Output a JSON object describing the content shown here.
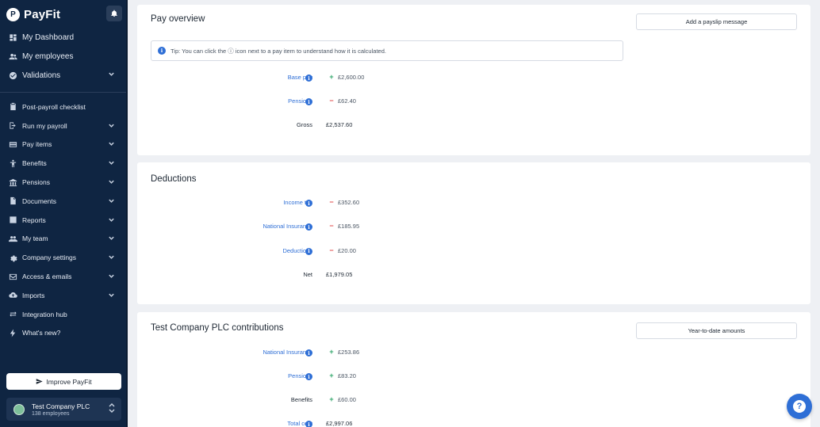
{
  "app": {
    "name": "PayFit"
  },
  "sidebar": {
    "top_items": [
      {
        "label": "My Dashboard",
        "icon": "dashboard-icon"
      },
      {
        "label": "My employees",
        "icon": "users-icon"
      },
      {
        "label": "Validations",
        "icon": "check-circle-icon",
        "has_chevron": true
      }
    ],
    "items": [
      {
        "label": "Post-payroll checklist",
        "icon": "clipboard-icon"
      },
      {
        "label": "Run my payroll",
        "icon": "run-icon",
        "has_chevron": true
      },
      {
        "label": "Pay items",
        "icon": "card-icon",
        "has_chevron": true
      },
      {
        "label": "Benefits",
        "icon": "person-icon",
        "has_chevron": true
      },
      {
        "label": "Pensions",
        "icon": "bank-icon",
        "has_chevron": true
      },
      {
        "label": "Documents",
        "icon": "document-icon",
        "has_chevron": true
      },
      {
        "label": "Reports",
        "icon": "report-icon",
        "has_chevron": true
      },
      {
        "label": "My team",
        "icon": "team-icon",
        "has_chevron": true
      },
      {
        "label": "Company settings",
        "icon": "gear-icon",
        "has_chevron": true
      },
      {
        "label": "Access & emails",
        "icon": "mail-icon",
        "has_chevron": true
      },
      {
        "label": "Imports",
        "icon": "cloud-upload-icon",
        "has_chevron": true
      },
      {
        "label": "Integration hub",
        "icon": "arrows-icon"
      },
      {
        "label": "What's new?",
        "icon": "bolt-icon"
      }
    ],
    "improve_label": "Improve PayFit",
    "company": {
      "name": "Test Company PLC",
      "employees": "138 employees"
    }
  },
  "pay_overview": {
    "title": "Pay overview",
    "button_label": "Add a payslip message",
    "tip": "Tip: You can click the ⓘ icon next to a pay item to understand how it is calculated.",
    "rows": [
      {
        "label": "Base pay",
        "sign": "+",
        "amount": "£2,600.00"
      },
      {
        "label": "Pensions",
        "sign": "−",
        "amount": "£62.40"
      }
    ],
    "total": {
      "label": "Gross",
      "amount": "£2,537.60"
    }
  },
  "deductions": {
    "title": "Deductions",
    "rows": [
      {
        "label": "Income tax",
        "sign": "−",
        "amount": "£352.60"
      },
      {
        "label": "National Insurance",
        "sign": "−",
        "amount": "£185.95"
      },
      {
        "label": "Deductions",
        "sign": "−",
        "amount": "£20.00"
      }
    ],
    "total": {
      "label": "Net",
      "amount": "£1,979.05"
    }
  },
  "contributions": {
    "title": "Test Company PLC contributions",
    "button_label": "Year-to-date amounts",
    "rows": [
      {
        "label": "National Insurance",
        "sign": "+",
        "amount": "£253.86"
      },
      {
        "label": "Pensions",
        "sign": "+",
        "amount": "£83.20"
      },
      {
        "label": "Benefits",
        "sign": "+",
        "amount": "£60.00"
      }
    ],
    "total": {
      "label": "Total cost",
      "amount": "£2,997.06"
    }
  },
  "help": {
    "glyph": "?"
  },
  "colors": {
    "sidebar_bg": "#0f2542",
    "link": "#2f6fd6",
    "plus": "#2fa66a",
    "minus": "#e0494a"
  }
}
